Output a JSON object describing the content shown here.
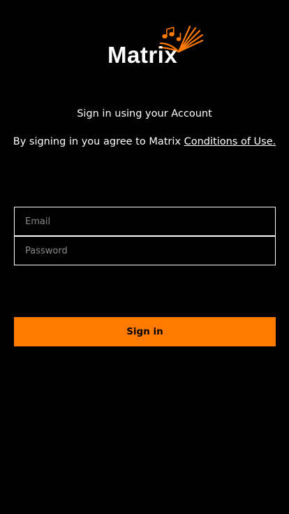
{
  "brand": {
    "name": "Matrix",
    "accent_color": "#ff7a00",
    "background_color": "#000000"
  },
  "intro": {
    "text": "Sign in using your Account"
  },
  "terms": {
    "prefix": "By signing in you agree to Matrix ",
    "link_label": "Conditions of Use."
  },
  "form": {
    "email_placeholder": "Email",
    "email_value": "",
    "password_placeholder": "Password",
    "password_value": "",
    "submit_label": "Sign in"
  },
  "icons": {
    "logo_mark": "music-notes-book-icon"
  }
}
